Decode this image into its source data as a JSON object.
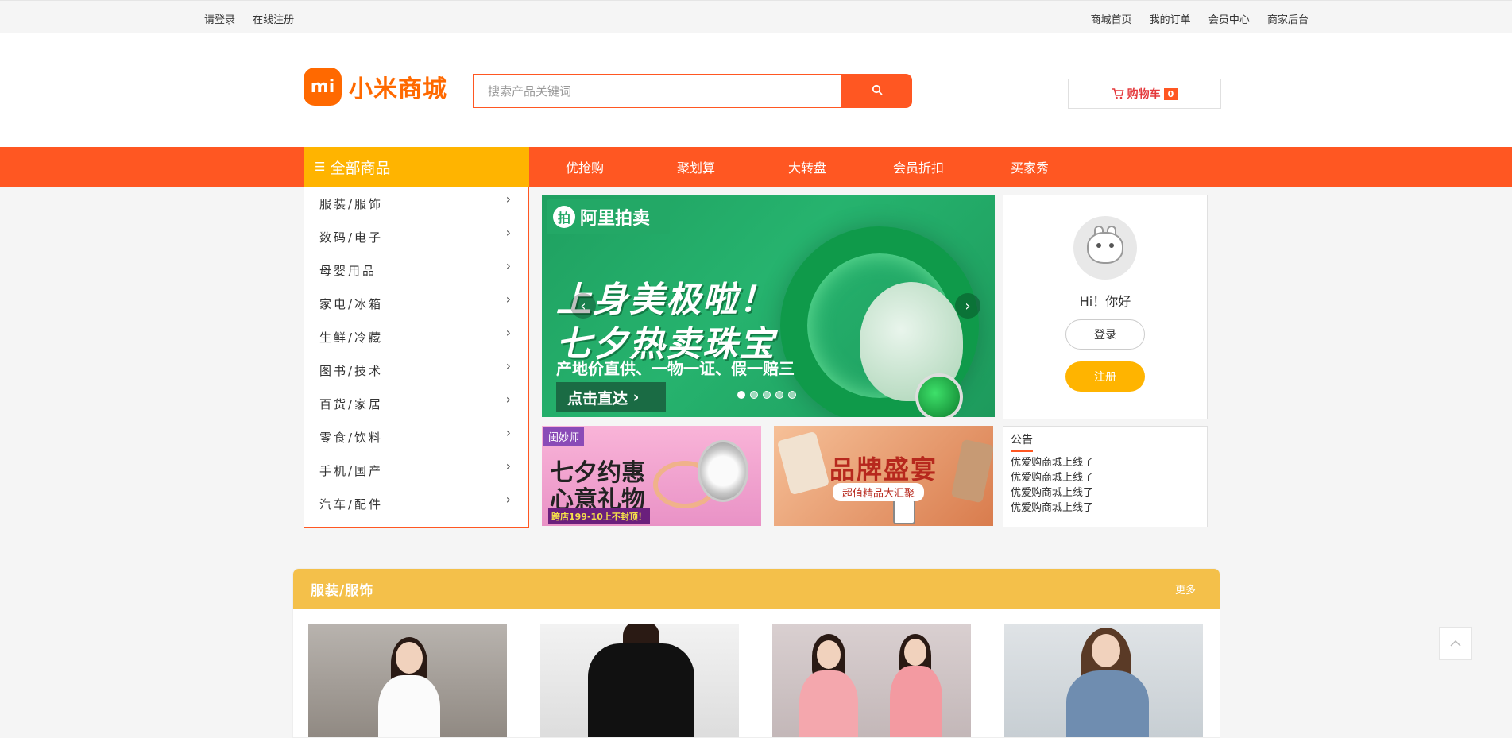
{
  "topbar": {
    "left": [
      "请登录",
      "在线注册"
    ],
    "right": [
      "商城首页",
      "我的订单",
      "会员中心",
      "商家后台"
    ]
  },
  "logo": {
    "mark": "mi",
    "text": "小米商城"
  },
  "search": {
    "placeholder": "搜索产品关键词",
    "value": ""
  },
  "cart": {
    "label": "购物车",
    "count": "0"
  },
  "nav": {
    "all_label": "全部商品",
    "links": [
      "优抢购",
      "聚划算",
      "大转盘",
      "会员折扣",
      "买家秀"
    ]
  },
  "categories": [
    "服装/服饰",
    "数码/电子",
    "母婴用品",
    "家电/冰箱",
    "生鲜/冷藏",
    "图书/技术",
    "百货/家居",
    "零食/饮料",
    "手机/国产",
    "汽车/配件"
  ],
  "banner": {
    "brand": "阿里拍卖",
    "headline1": "上身美极啦！",
    "headline2": "七夕热卖珠宝",
    "subline": "产地价直供、一物一证、假一赔三",
    "cta": "点击直达",
    "slides": 5,
    "active_slide": 1
  },
  "user": {
    "greeting": "Hi！你好",
    "login": "登录",
    "register": "注册"
  },
  "promo1": {
    "tag": "闺妙师",
    "line1": "七夕约惠",
    "line2": "心意礼物",
    "line3": "跨店199-10上不封顶！"
  },
  "promo2": {
    "title": "品牌盛宴",
    "subtitle": "超值精品大汇聚"
  },
  "notice": {
    "title": "公告",
    "items": [
      "优爱购商城上线了",
      "优爱购商城上线了",
      "优爱购商城上线了",
      "优爱购商城上线了"
    ]
  },
  "section": {
    "title": "服装/服饰",
    "more": "更多"
  },
  "colors": {
    "primary": "#ff5722",
    "accent": "#ffb400",
    "section_header": "#f4c04a",
    "logo": "#ff6900"
  }
}
